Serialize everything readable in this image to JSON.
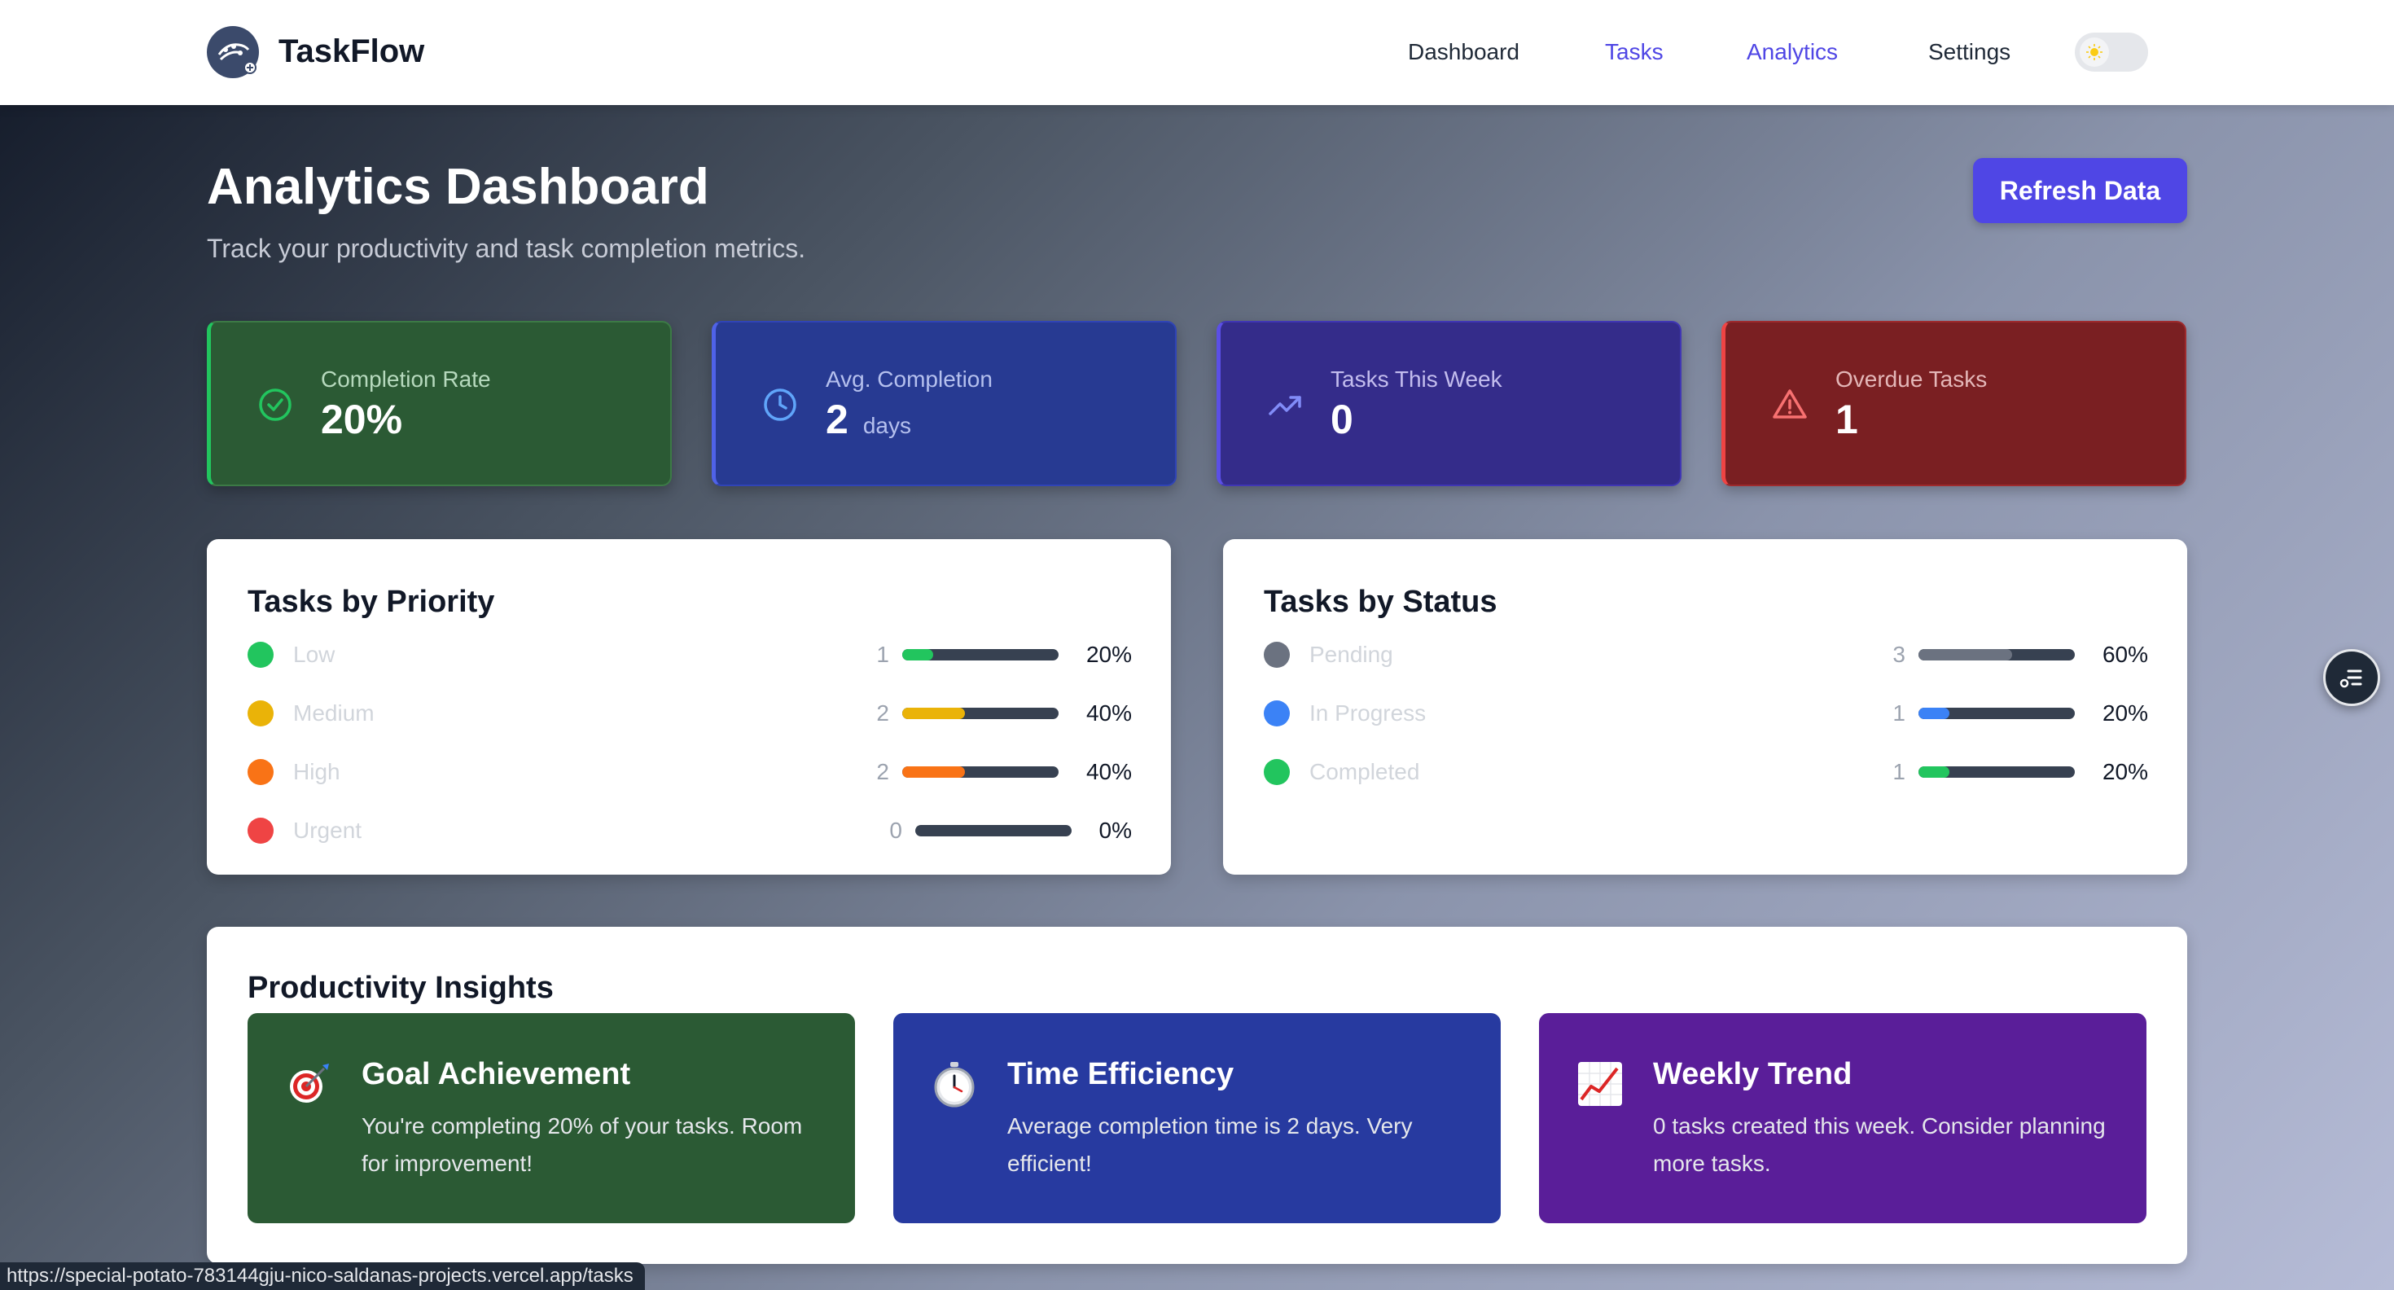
{
  "app": {
    "brand": "TaskFlow",
    "logo_icon": "taskflow-logo-icon"
  },
  "nav": {
    "items": [
      {
        "label": "Dashboard",
        "active": false
      },
      {
        "label": "Tasks",
        "active": true
      },
      {
        "label": "Analytics",
        "active": true
      },
      {
        "label": "Settings",
        "active": false
      }
    ],
    "theme_toggle_icon": "sun-icon"
  },
  "header": {
    "title": "Analytics Dashboard",
    "subtitle": "Track your productivity and task completion metrics.",
    "refresh_label": "Refresh Data"
  },
  "stats": [
    {
      "label": "Completion Rate",
      "value": "20%",
      "unit": "",
      "icon": "check-circle-icon",
      "color": "#22c55e"
    },
    {
      "label": "Avg. Completion",
      "value": "2",
      "unit": "days",
      "icon": "clock-icon",
      "color": "#60a5fa"
    },
    {
      "label": "Tasks This Week",
      "value": "0",
      "unit": "",
      "icon": "trending-up-icon",
      "color": "#818cf8"
    },
    {
      "label": "Overdue Tasks",
      "value": "1",
      "unit": "",
      "icon": "warning-triangle-icon",
      "color": "#f87171"
    }
  ],
  "priority": {
    "title": "Tasks by Priority",
    "rows": [
      {
        "label": "Low",
        "count": "1",
        "percent": "20%",
        "fraction": 0.2,
        "color": "#22c55e"
      },
      {
        "label": "Medium",
        "count": "2",
        "percent": "40%",
        "fraction": 0.4,
        "color": "#eab308"
      },
      {
        "label": "High",
        "count": "2",
        "percent": "40%",
        "fraction": 0.4,
        "color": "#f97316"
      },
      {
        "label": "Urgent",
        "count": "0",
        "percent": "0%",
        "fraction": 0.0,
        "color": "#ef4444"
      }
    ]
  },
  "status": {
    "title": "Tasks by Status",
    "rows": [
      {
        "label": "Pending",
        "count": "3",
        "percent": "60%",
        "fraction": 0.6,
        "color": "#6b7280"
      },
      {
        "label": "In Progress",
        "count": "1",
        "percent": "20%",
        "fraction": 0.2,
        "color": "#3b82f6"
      },
      {
        "label": "Completed",
        "count": "1",
        "percent": "20%",
        "fraction": 0.2,
        "color": "#22c55e"
      }
    ]
  },
  "insights": {
    "title": "Productivity Insights",
    "cards": [
      {
        "title": "Goal Achievement",
        "text": "You're completing 20% of your tasks. Room for improvement!",
        "icon": "target-icon"
      },
      {
        "title": "Time Efficiency",
        "text": "Average completion time is 2 days. Very efficient!",
        "icon": "stopwatch-icon"
      },
      {
        "title": "Weekly Trend",
        "text": "0 tasks created this week. Consider planning more tasks.",
        "icon": "chart-trend-icon"
      }
    ]
  },
  "floating_button_icon": "menu-list-icon",
  "status_bar_url": "https://special-potato-783144gju-nico-saldanas-projects.vercel.app/tasks"
}
